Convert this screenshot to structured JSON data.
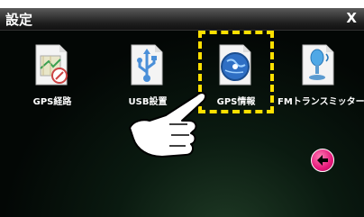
{
  "header": {
    "title": "設定",
    "close_label": "X"
  },
  "apps": [
    {
      "label": "GPS経路",
      "icon": "gps-route-icon"
    },
    {
      "label": "USB設置",
      "icon": "usb-icon"
    },
    {
      "label": "GPS情報",
      "icon": "gps-info-globe-icon"
    },
    {
      "label": "FMトランスミッター",
      "icon": "fm-transmitter-icon"
    }
  ],
  "highlight": {
    "app": "GPS情報",
    "color": "#ffe000"
  },
  "back_button": {
    "icon": "back-arrow-icon",
    "color": "#e5177a"
  },
  "colors": {
    "title_bar": "#1e1e1e",
    "background": "#030705"
  }
}
